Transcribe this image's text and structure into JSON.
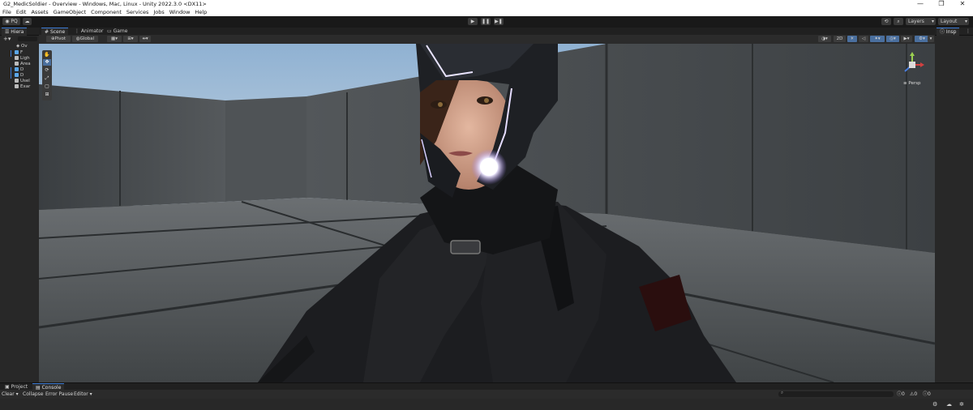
{
  "window": {
    "title": "G2_MedicSoldier - Overview - Windows, Mac, Linux - Unity 2022.3.0 <DX11>",
    "minimize": "—",
    "maximize": "❐",
    "close": "✕"
  },
  "menu": [
    "File",
    "Edit",
    "Assets",
    "GameObject",
    "Component",
    "Services",
    "Jobs",
    "Window",
    "Help"
  ],
  "toolbar": {
    "account_label": "PQ",
    "play_icon": "▶",
    "pause_icon": "❚❚",
    "step_icon": "▶❚",
    "layers_label": "Layers",
    "layout_label": "Layout"
  },
  "hierarchy": {
    "tab_label": "Hiera",
    "root": "Ov",
    "rows": [
      "F",
      "Ligh",
      "Area",
      "D",
      "D",
      "Usel",
      "Exar"
    ]
  },
  "scene": {
    "tabs": [
      "Scene",
      "Animator",
      "Game"
    ],
    "pivot_label": "Pivot",
    "global_label": "Global",
    "mode_2d": "2D",
    "persp_label": "Persp"
  },
  "inspector": {
    "tab_label": "Insp"
  },
  "bottom": {
    "tabs": [
      "Project",
      "Console"
    ],
    "clear_label": "Clear",
    "collapse_label": "Collapse",
    "error_pause_label": "Error Pause",
    "editor_label": "Editor",
    "count_logs": "0",
    "count_warnings": "0",
    "count_errors": "0"
  },
  "colors": {
    "accent": "#3d7cd6",
    "panel": "#282828",
    "background": "#191919"
  }
}
